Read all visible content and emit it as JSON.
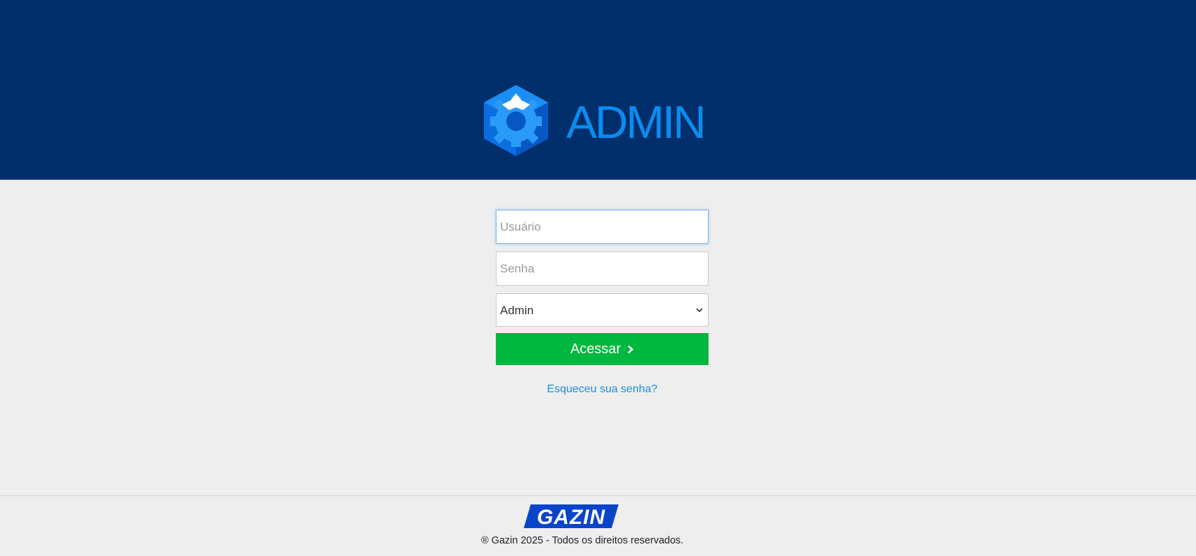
{
  "header": {
    "logo_text": "ADMIN",
    "logo_icon": "gear-cube-icon",
    "background_color": "#002f6c",
    "logo_color": "#0a8cf0"
  },
  "login": {
    "username_placeholder": "Usuário",
    "username_value": "",
    "password_placeholder": "Senha",
    "password_value": "",
    "system_select_value": "Admin",
    "submit_label": "Acessar",
    "submit_color": "#00b83f",
    "forgot_password_link": "Esqueceu sua senha?"
  },
  "footer": {
    "brand_logo_text": "Gazin",
    "copyright": "® Gazin 2025 - Todos os direitos reservados."
  }
}
